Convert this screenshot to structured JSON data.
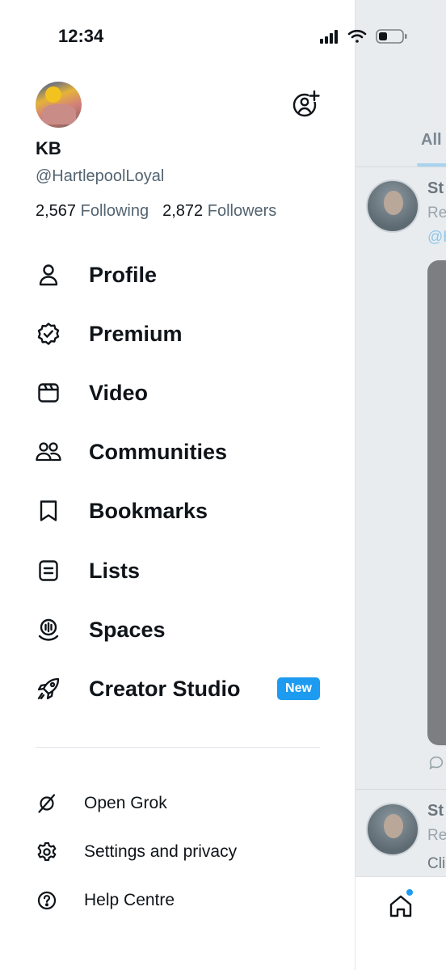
{
  "status_bar": {
    "time": "12:34"
  },
  "account": {
    "display_name": "KB",
    "handle": "@HartlepoolLoyal",
    "following_count": "2,567",
    "following_label": "Following",
    "followers_count": "2,872",
    "followers_label": "Followers"
  },
  "menu": [
    {
      "label": "Profile",
      "icon": "person-icon"
    },
    {
      "label": "Premium",
      "icon": "verified-badge-icon"
    },
    {
      "label": "Video",
      "icon": "video-icon"
    },
    {
      "label": "Communities",
      "icon": "communities-icon"
    },
    {
      "label": "Bookmarks",
      "icon": "bookmark-icon"
    },
    {
      "label": "Lists",
      "icon": "list-icon"
    },
    {
      "label": "Spaces",
      "icon": "spaces-icon"
    },
    {
      "label": "Creator Studio",
      "icon": "rocket-icon",
      "badge": "New"
    }
  ],
  "secondary_menu": [
    {
      "label": "Open Grok",
      "icon": "grok-icon"
    },
    {
      "label": "Settings and privacy",
      "icon": "gear-icon"
    },
    {
      "label": "Help Centre",
      "icon": "help-icon"
    }
  ],
  "background_feed": {
    "tab_label": "All",
    "post1_name": "St",
    "post1_meta": "Re",
    "post1_link": "@H",
    "post2_name": "St",
    "post2_meta": "Re",
    "post2_text": "Cli"
  },
  "colors": {
    "accent": "#1d9bf0",
    "text": "#0f1419",
    "secondary_text": "#536471"
  }
}
